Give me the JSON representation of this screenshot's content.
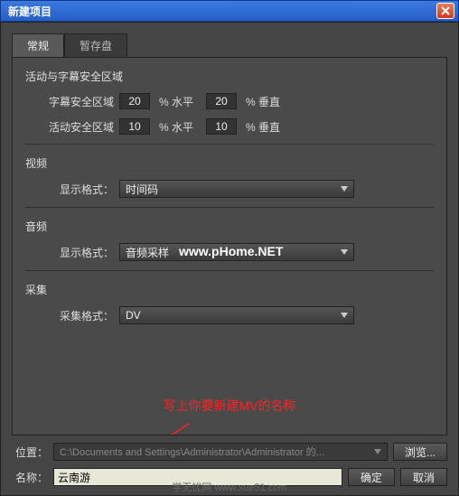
{
  "window": {
    "title": "新建项目"
  },
  "tabs": {
    "general": "常规",
    "scratch": "暂存盘"
  },
  "groups": {
    "safe": {
      "title": "活动与字幕安全区域",
      "subtitle_label": "字幕安全区域",
      "action_label": "活动安全区域",
      "subtitle_h": "20",
      "subtitle_v": "20",
      "action_h": "10",
      "action_v": "10",
      "pct_h": "% 水平",
      "pct_v": "% 垂直"
    },
    "video": {
      "title": "视频",
      "format_label": "显示格式：",
      "value": "时间码"
    },
    "audio": {
      "title": "音频",
      "format_label": "显示格式：",
      "value": "音频采样"
    },
    "capture": {
      "title": "采集",
      "format_label": "采集格式：",
      "value": "DV"
    }
  },
  "annotation": "写上你要新建MV的名称",
  "watermark": "www.pHome.NET",
  "footer": {
    "location_label": "位置：",
    "location_value": "C:\\Documents and Settings\\Administrator\\Administrator 的...",
    "browse": "浏览...",
    "name_label": "名称：",
    "name_value": "云南游",
    "ok": "确定",
    "cancel": "取消"
  },
  "caption": "学无忧网  www.xue51.com"
}
